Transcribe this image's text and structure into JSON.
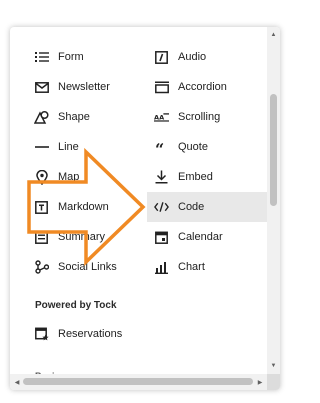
{
  "left_items": [
    {
      "label": "Form",
      "icon": "list-icon"
    },
    {
      "label": "Newsletter",
      "icon": "mail-icon"
    },
    {
      "label": "Shape",
      "icon": "shape-icon"
    },
    {
      "label": "Line",
      "icon": "line-icon"
    },
    {
      "label": "Map",
      "icon": "map-pin-icon"
    },
    {
      "label": "Markdown",
      "icon": "markdown-icon"
    },
    {
      "label": "Summary",
      "icon": "summary-icon"
    },
    {
      "label": "Social Links",
      "icon": "social-links-icon"
    }
  ],
  "right_items": [
    {
      "label": "Audio",
      "icon": "audio-icon"
    },
    {
      "label": "Accordion",
      "icon": "accordion-icon"
    },
    {
      "label": "Scrolling",
      "icon": "scrolling-icon"
    },
    {
      "label": "Quote",
      "icon": "quote-icon"
    },
    {
      "label": "Embed",
      "icon": "embed-icon"
    },
    {
      "label": "Code",
      "icon": "code-icon"
    },
    {
      "label": "Calendar",
      "icon": "calendar-icon"
    },
    {
      "label": "Chart",
      "icon": "chart-icon"
    }
  ],
  "section": {
    "title": "Powered by Tock",
    "item": {
      "label": "Reservations",
      "icon": "reservations-icon"
    },
    "next_title": "Business"
  },
  "highlighted_item": "Code",
  "colors": {
    "arrow": "#f08a24",
    "highlight": "#e8e8e8"
  }
}
